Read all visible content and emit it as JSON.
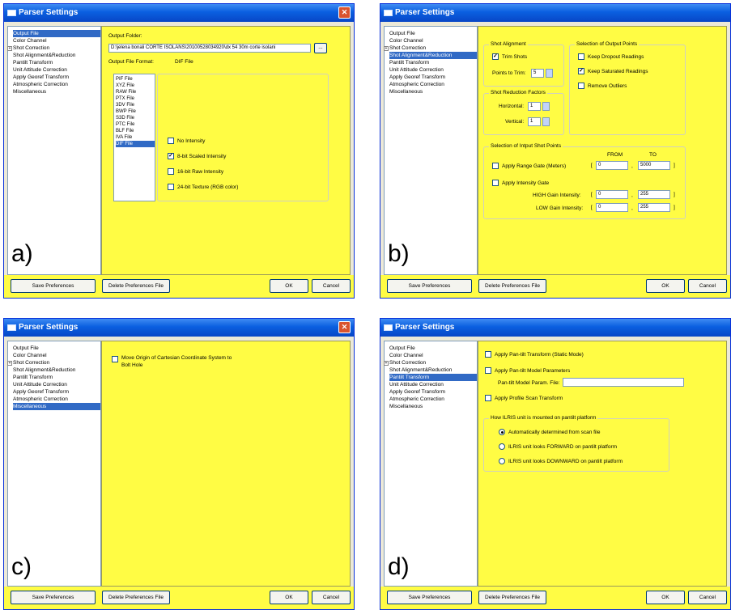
{
  "window_title": "Parser Settings",
  "tree_items": [
    "Output File",
    "Color Channel",
    "Shot Correction",
    "Shot Alignment&Reduction",
    "Pantilt Transform",
    "Unit Attitude Correction",
    "Apply Georef Transform",
    "Atmospheric Correction",
    "Miscellaneous"
  ],
  "buttons": {
    "save": "Save Preferences",
    "delete": "Delete Preferences File",
    "ok": "OK",
    "cancel": "Cancel"
  },
  "panels": {
    "a": {
      "letter": "a)",
      "output_folder_label": "Output Folder:",
      "output_folder_value": "D:\\jelena bonali CORTE ISOLANS\\20100528034920\\dx 54 30m corte isolani",
      "browse": "...",
      "format_label": "Output File Format:",
      "format_value": "DIF File",
      "formats": [
        "PIF File",
        "XYZ File",
        "RAW File",
        "PTX File",
        "3DV File",
        "BWP File",
        "S3D File",
        "PTC File",
        "BLF File",
        "IVA File",
        "DIF File"
      ],
      "intensity": [
        {
          "label": "No Intensity",
          "checked": false
        },
        {
          "label": "8-bit Scaled Intensity",
          "checked": true
        },
        {
          "label": "16-bit Raw Intensity",
          "checked": false
        },
        {
          "label": "24-bit Texture (RGB color)",
          "checked": false
        }
      ]
    },
    "b": {
      "letter": "b)",
      "shot_alignment": "Shot Alignment",
      "trim_shots": "Trim Shots",
      "points_to_trim": "Points to Trim:",
      "points_value": "5",
      "reduction": "Shot Reduction Factors",
      "horizontal": "Horizontal:",
      "horizontal_value": "1",
      "vertical": "Vertical:",
      "vertical_value": "1",
      "output_points": "Selection of Output Points",
      "keep_dropout": "Keep Dropout Readings",
      "keep_saturated": "Keep Saturated Readings",
      "remove_outliers": "Remove Outliers",
      "input_points": "Selection of Intput Shot Points",
      "from": "FROM",
      "to": "TO",
      "range_gate": "Apply Range Gate (Meters)",
      "range_from": "0",
      "range_to": "5000",
      "intensity_gate": "Apply Intensity Gate",
      "high_gain": "HIGH Gain Intensity:",
      "high_from": "0",
      "high_to": "255",
      "low_gain": "LOW Gain Intensity:",
      "low_from": "0",
      "low_to": "255"
    },
    "c": {
      "letter": "c)",
      "move_origin": "Move Origin of Cartesian Coordinate System to",
      "move_origin2": "Bolt Hole"
    },
    "d": {
      "letter": "d)",
      "pantilt_static": "Apply Pan-tilt Transform (Static Mode)",
      "pantilt_model": "Apply Pan-tilt Model Parameters",
      "param_file": "Pan-tilt Model Param. File:",
      "profile_scan": "Apply Profile Scan Transform",
      "mount_group": "How ILRIS unit is mounted on pantilt platform",
      "auto": "Automatically determined from scan file",
      "forward": "ILRIS unit looks FORWARD on pantilt platform",
      "downward": "ILRIS unit looks DOWNWARD on pantilt platform"
    }
  }
}
